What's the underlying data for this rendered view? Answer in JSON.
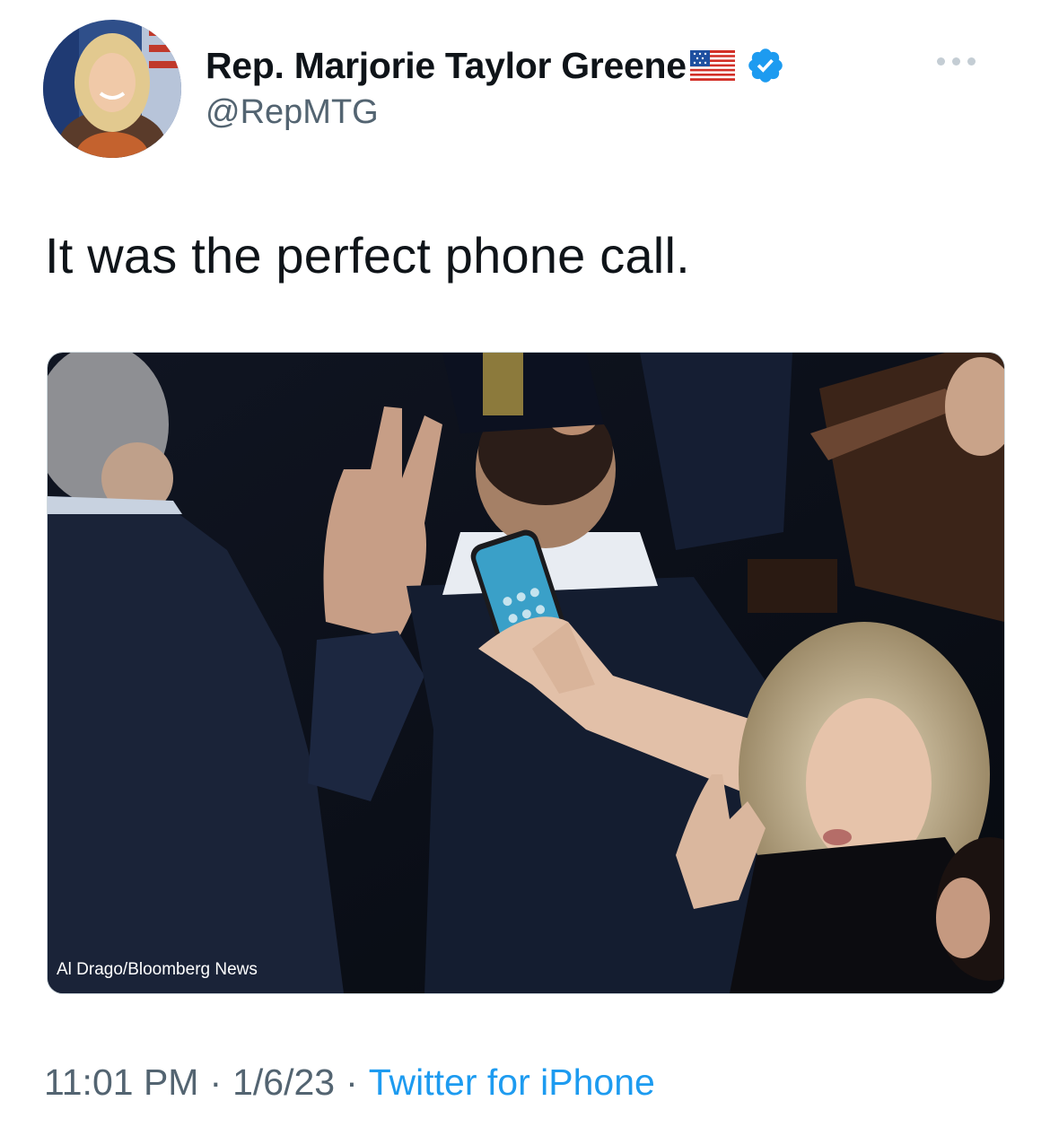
{
  "author": {
    "display_name": "Rep. Marjorie Taylor Greene",
    "handle": "@RepMTG",
    "flag_icon": "us-flag-emoji",
    "verified_icon": "verified-badge-icon"
  },
  "tweet": {
    "text": "It was the perfect phone call.",
    "photo_credit": "Al Drago/Bloomberg News"
  },
  "meta": {
    "time": "11:01 PM",
    "separator": "·",
    "date": "1/6/23",
    "source": "Twitter for iPhone"
  },
  "colors": {
    "text": "#0f1419",
    "secondary": "#536471",
    "link": "#1d9bf0",
    "verified": "#1d9bf0"
  }
}
